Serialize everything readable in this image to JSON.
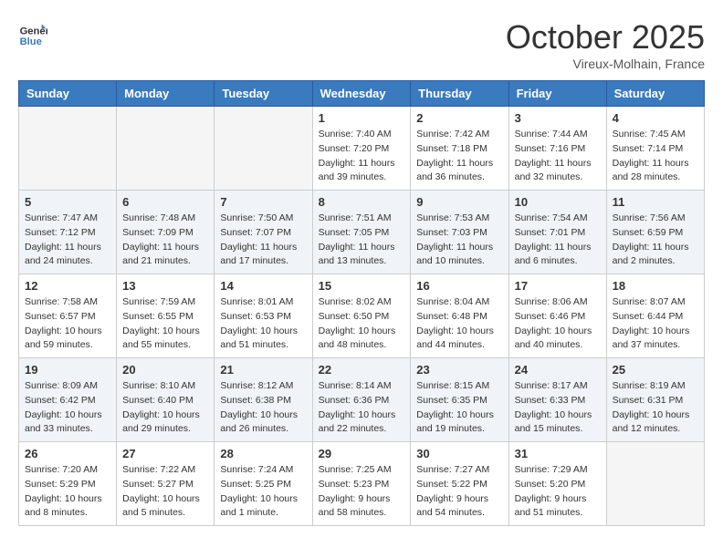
{
  "header": {
    "logo_general": "General",
    "logo_blue": "Blue",
    "month_title": "October 2025",
    "location": "Vireux-Molhain, France"
  },
  "weekdays": [
    "Sunday",
    "Monday",
    "Tuesday",
    "Wednesday",
    "Thursday",
    "Friday",
    "Saturday"
  ],
  "weeks": [
    [
      {
        "day": "",
        "info": ""
      },
      {
        "day": "",
        "info": ""
      },
      {
        "day": "",
        "info": ""
      },
      {
        "day": "1",
        "info": "Sunrise: 7:40 AM\nSunset: 7:20 PM\nDaylight: 11 hours\nand 39 minutes."
      },
      {
        "day": "2",
        "info": "Sunrise: 7:42 AM\nSunset: 7:18 PM\nDaylight: 11 hours\nand 36 minutes."
      },
      {
        "day": "3",
        "info": "Sunrise: 7:44 AM\nSunset: 7:16 PM\nDaylight: 11 hours\nand 32 minutes."
      },
      {
        "day": "4",
        "info": "Sunrise: 7:45 AM\nSunset: 7:14 PM\nDaylight: 11 hours\nand 28 minutes."
      }
    ],
    [
      {
        "day": "5",
        "info": "Sunrise: 7:47 AM\nSunset: 7:12 PM\nDaylight: 11 hours\nand 24 minutes."
      },
      {
        "day": "6",
        "info": "Sunrise: 7:48 AM\nSunset: 7:09 PM\nDaylight: 11 hours\nand 21 minutes."
      },
      {
        "day": "7",
        "info": "Sunrise: 7:50 AM\nSunset: 7:07 PM\nDaylight: 11 hours\nand 17 minutes."
      },
      {
        "day": "8",
        "info": "Sunrise: 7:51 AM\nSunset: 7:05 PM\nDaylight: 11 hours\nand 13 minutes."
      },
      {
        "day": "9",
        "info": "Sunrise: 7:53 AM\nSunset: 7:03 PM\nDaylight: 11 hours\nand 10 minutes."
      },
      {
        "day": "10",
        "info": "Sunrise: 7:54 AM\nSunset: 7:01 PM\nDaylight: 11 hours\nand 6 minutes."
      },
      {
        "day": "11",
        "info": "Sunrise: 7:56 AM\nSunset: 6:59 PM\nDaylight: 11 hours\nand 2 minutes."
      }
    ],
    [
      {
        "day": "12",
        "info": "Sunrise: 7:58 AM\nSunset: 6:57 PM\nDaylight: 10 hours\nand 59 minutes."
      },
      {
        "day": "13",
        "info": "Sunrise: 7:59 AM\nSunset: 6:55 PM\nDaylight: 10 hours\nand 55 minutes."
      },
      {
        "day": "14",
        "info": "Sunrise: 8:01 AM\nSunset: 6:53 PM\nDaylight: 10 hours\nand 51 minutes."
      },
      {
        "day": "15",
        "info": "Sunrise: 8:02 AM\nSunset: 6:50 PM\nDaylight: 10 hours\nand 48 minutes."
      },
      {
        "day": "16",
        "info": "Sunrise: 8:04 AM\nSunset: 6:48 PM\nDaylight: 10 hours\nand 44 minutes."
      },
      {
        "day": "17",
        "info": "Sunrise: 8:06 AM\nSunset: 6:46 PM\nDaylight: 10 hours\nand 40 minutes."
      },
      {
        "day": "18",
        "info": "Sunrise: 8:07 AM\nSunset: 6:44 PM\nDaylight: 10 hours\nand 37 minutes."
      }
    ],
    [
      {
        "day": "19",
        "info": "Sunrise: 8:09 AM\nSunset: 6:42 PM\nDaylight: 10 hours\nand 33 minutes."
      },
      {
        "day": "20",
        "info": "Sunrise: 8:10 AM\nSunset: 6:40 PM\nDaylight: 10 hours\nand 29 minutes."
      },
      {
        "day": "21",
        "info": "Sunrise: 8:12 AM\nSunset: 6:38 PM\nDaylight: 10 hours\nand 26 minutes."
      },
      {
        "day": "22",
        "info": "Sunrise: 8:14 AM\nSunset: 6:36 PM\nDaylight: 10 hours\nand 22 minutes."
      },
      {
        "day": "23",
        "info": "Sunrise: 8:15 AM\nSunset: 6:35 PM\nDaylight: 10 hours\nand 19 minutes."
      },
      {
        "day": "24",
        "info": "Sunrise: 8:17 AM\nSunset: 6:33 PM\nDaylight: 10 hours\nand 15 minutes."
      },
      {
        "day": "25",
        "info": "Sunrise: 8:19 AM\nSunset: 6:31 PM\nDaylight: 10 hours\nand 12 minutes."
      }
    ],
    [
      {
        "day": "26",
        "info": "Sunrise: 7:20 AM\nSunset: 5:29 PM\nDaylight: 10 hours\nand 8 minutes."
      },
      {
        "day": "27",
        "info": "Sunrise: 7:22 AM\nSunset: 5:27 PM\nDaylight: 10 hours\nand 5 minutes."
      },
      {
        "day": "28",
        "info": "Sunrise: 7:24 AM\nSunset: 5:25 PM\nDaylight: 10 hours\nand 1 minute."
      },
      {
        "day": "29",
        "info": "Sunrise: 7:25 AM\nSunset: 5:23 PM\nDaylight: 9 hours\nand 58 minutes."
      },
      {
        "day": "30",
        "info": "Sunrise: 7:27 AM\nSunset: 5:22 PM\nDaylight: 9 hours\nand 54 minutes."
      },
      {
        "day": "31",
        "info": "Sunrise: 7:29 AM\nSunset: 5:20 PM\nDaylight: 9 hours\nand 51 minutes."
      },
      {
        "day": "",
        "info": ""
      }
    ]
  ]
}
